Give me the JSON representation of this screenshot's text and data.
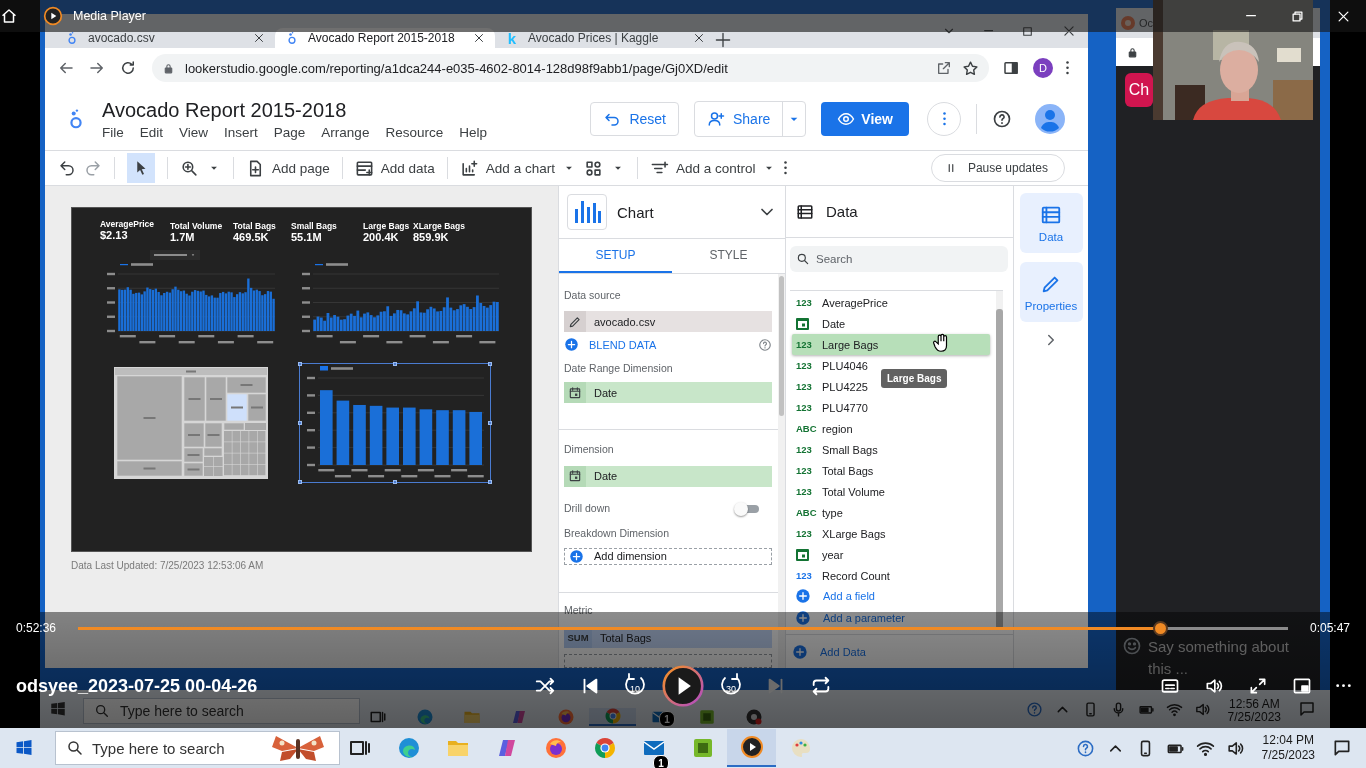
{
  "player": {
    "title": "Media Player",
    "video_title": "odsyee_2023-07-25 00-04-26",
    "elapsed": "0:52:36",
    "remaining": "0:05:47",
    "level": 0.894,
    "playing": false,
    "rewind": "10",
    "forward": "30",
    "next_disabled": true
  },
  "browser": {
    "tabs": [
      {
        "label": "avocado.csv",
        "selected": false,
        "kind": "looker"
      },
      {
        "label": "Avocado Report 2015-2018",
        "selected": true,
        "kind": "looker"
      },
      {
        "label": "Avocado Prices | Kaggle",
        "selected": false,
        "kind": "letter",
        "icon_text": "k"
      }
    ],
    "url": "lookerstudio.google.com/reporting/a1dca244-e035-4602-8014-128d98f9abb1/page/Gj0XD/edit",
    "profile": "D"
  },
  "app": {
    "title": "Avocado Report 2015-2018",
    "menus": [
      "File",
      "Edit",
      "View",
      "Insert",
      "Page",
      "Arrange",
      "Resource",
      "Help"
    ],
    "reset": "Reset",
    "share": "Share",
    "view": "View"
  },
  "toolbar": {
    "pointer_selected": true,
    "add_page": "Add page",
    "add_data": "Add data",
    "add_chart": "Add a chart",
    "add_control": "Add a control",
    "pause": "Pause updates"
  },
  "report": {
    "scorecards": [
      {
        "label": "AveragePrice",
        "value": "$2.13"
      },
      {
        "label": "Total Volume",
        "value": "1.7M"
      },
      {
        "label": "Total Bags",
        "value": "469.5K"
      },
      {
        "label": "Small Bags",
        "value": "55.1M"
      },
      {
        "label": "Large Bags",
        "value": "200.4K"
      },
      {
        "label": "XLarge Bags",
        "value": "859.9K"
      }
    ],
    "charts": [
      {
        "kind": "timeseries",
        "selected": false
      },
      {
        "kind": "timeseries",
        "selected": false
      },
      {
        "kind": "bars",
        "selected": true
      }
    ],
    "updated": "Data Last Updated: 7/25/2023 12:53:06 AM"
  },
  "chart_panel": {
    "title": "Chart",
    "tabs": [
      {
        "label": "SETUP",
        "selected": true
      },
      {
        "label": "STYLE",
        "selected": false
      }
    ],
    "data_source_label": "Data source",
    "data_source": "avocado.csv",
    "blend": "BLEND DATA",
    "date_range_label": "Date Range Dimension",
    "date_range": "Date",
    "dimension_label": "Dimension",
    "dimension": "Date",
    "drill_down_label": "Drill down",
    "drill_down": false,
    "breakdown_label": "Breakdown Dimension",
    "add_dimension": "Add dimension",
    "metric_label": "Metric",
    "metric_aggregation": "SUM",
    "metric": "Total Bags"
  },
  "data_panel": {
    "title": "Data",
    "search": {
      "placeholder": "Search"
    },
    "fields": [
      {
        "kind": "number",
        "badge": "123",
        "name": "AveragePrice",
        "color": "#137333",
        "selected": false
      },
      {
        "kind": "date",
        "name": "Date",
        "color": "#137333",
        "selected": false
      },
      {
        "kind": "number",
        "badge": "123",
        "name": "Large Bags",
        "color": "#137333",
        "selected": true
      },
      {
        "kind": "number",
        "badge": "123",
        "name": "PLU4046",
        "color": "#137333",
        "selected": false
      },
      {
        "kind": "number",
        "badge": "123",
        "name": "PLU4225",
        "color": "#137333",
        "selected": false
      },
      {
        "kind": "number",
        "badge": "123",
        "name": "PLU4770",
        "color": "#137333",
        "selected": false
      },
      {
        "kind": "text",
        "badge": "ABC",
        "name": "region",
        "color": "#137333",
        "selected": false
      },
      {
        "kind": "number",
        "badge": "123",
        "name": "Small Bags",
        "color": "#137333",
        "selected": false
      },
      {
        "kind": "number",
        "badge": "123",
        "name": "Total Bags",
        "color": "#137333",
        "selected": false
      },
      {
        "kind": "number",
        "badge": "123",
        "name": "Total Volume",
        "color": "#137333",
        "selected": false
      },
      {
        "kind": "text",
        "badge": "ABC",
        "name": "type",
        "color": "#137333",
        "selected": false
      },
      {
        "kind": "number",
        "badge": "123",
        "name": "XLarge Bags",
        "color": "#137333",
        "selected": false
      },
      {
        "kind": "date",
        "name": "year",
        "color": "#137333",
        "selected": false
      },
      {
        "kind": "number",
        "badge": "123",
        "name": "Record Count",
        "color": "#1a73e8",
        "selected": false
      }
    ],
    "add_field": "Add a field",
    "add_parameter": "Add a parameter",
    "add_data": "Add Data",
    "tooltip": "Large Bags"
  },
  "rail": [
    {
      "label": "Data",
      "kind": "data"
    },
    {
      "label": "Properties",
      "kind": "properties"
    }
  ],
  "chat": {
    "tab": "Oc",
    "button": "Ch",
    "placeholder": "Say something about this ..."
  },
  "desktop_taskbar": {
    "search": {
      "placeholder": "Type here to search"
    },
    "apps": [
      {
        "kind": "taskview",
        "active": false
      },
      {
        "kind": "edge",
        "active": false
      },
      {
        "kind": "folder",
        "active": false
      },
      {
        "kind": "copilot",
        "active": false
      },
      {
        "kind": "firefox",
        "active": false
      },
      {
        "kind": "chrome",
        "active": true
      },
      {
        "kind": "mail",
        "active": false,
        "badge": "1"
      },
      {
        "kind": "green",
        "active": false
      },
      {
        "kind": "recorder",
        "active": false
      }
    ],
    "time": "12:56 AM",
    "date": "7/25/2023"
  },
  "taskbar": {
    "search": {
      "placeholder": "Type here to search"
    },
    "apps": [
      {
        "kind": "taskview",
        "active": false
      },
      {
        "kind": "edge",
        "active": false
      },
      {
        "kind": "folder",
        "active": false
      },
      {
        "kind": "copilot",
        "active": false
      },
      {
        "kind": "firefox",
        "active": false
      },
      {
        "kind": "chrome",
        "active": false
      },
      {
        "kind": "mail",
        "active": false,
        "badge": "1"
      },
      {
        "kind": "green",
        "active": false
      },
      {
        "kind": "player",
        "active": true
      },
      {
        "kind": "paint",
        "active": false
      }
    ],
    "time": "12:04 PM",
    "date": "7/25/2023"
  }
}
